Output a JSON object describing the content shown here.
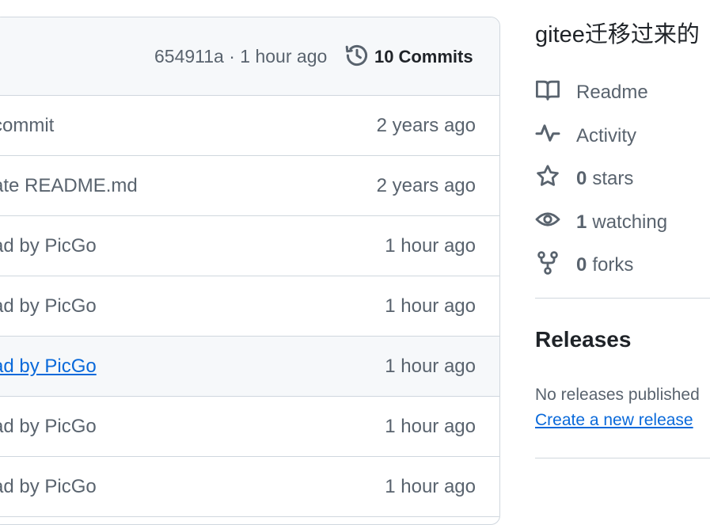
{
  "latest_commit": {
    "sha": "654911a",
    "separator": "·",
    "age": "1 hour ago",
    "commits_count": "10",
    "commits_label": "Commits"
  },
  "files": [
    {
      "message": "commit",
      "age": "2 years ago"
    },
    {
      "message": "ate README.md",
      "age": "2 years ago"
    },
    {
      "message": "ad by PicGo",
      "age": "1 hour ago"
    },
    {
      "message": "ad by PicGo",
      "age": "1 hour ago"
    },
    {
      "message": "ad by PicGo",
      "age": "1 hour ago",
      "hovered": true
    },
    {
      "message": "ad by PicGo",
      "age": "1 hour ago"
    },
    {
      "message": "ad by PicGo",
      "age": "1 hour ago"
    }
  ],
  "sidebar": {
    "about": "gitee迁移过来的",
    "readme": "Readme",
    "activity": "Activity",
    "stars_count": "0",
    "stars_label": "stars",
    "watching_count": "1",
    "watching_label": "watching",
    "forks_count": "0",
    "forks_label": "forks",
    "releases_title": "Releases",
    "no_releases": "No releases published",
    "create_release": "Create a new release"
  },
  "colors": {
    "text": "#1f2328",
    "muted": "#59636e",
    "link": "#0969da",
    "border": "#d0d7de",
    "header_bg": "#f6f8fa"
  }
}
